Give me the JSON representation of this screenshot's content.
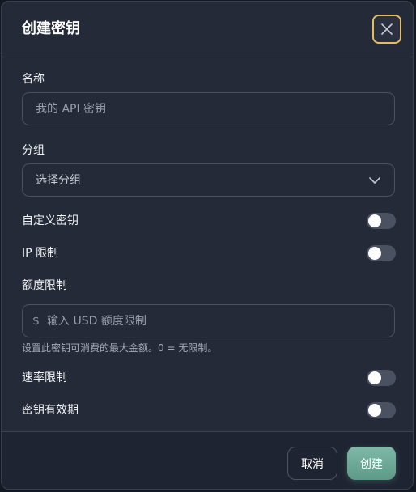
{
  "dialog": {
    "title": "创建密钥"
  },
  "fields": {
    "name": {
      "label": "名称",
      "placeholder": "我的 API 密钥",
      "value": ""
    },
    "group": {
      "label": "分组",
      "selected": "选择分组"
    },
    "custom_key": {
      "label": "自定义密钥",
      "enabled": false
    },
    "ip_limit": {
      "label": "IP 限制",
      "enabled": false
    },
    "quota": {
      "label": "额度限制",
      "currency_symbol": "$",
      "placeholder": "输入 USD 额度限制",
      "help": "设置此密钥可消费的最大金额。0 = 无限制。"
    },
    "rate_limit": {
      "label": "速率限制",
      "enabled": false
    },
    "expiry": {
      "label": "密钥有效期",
      "enabled": false
    }
  },
  "footer": {
    "cancel_label": "取消",
    "create_label": "创建"
  },
  "colors": {
    "background": "#242a38",
    "focus_ring": "#e4bd62",
    "primary": "#6fa996",
    "toggle_off": "#4a5160"
  }
}
